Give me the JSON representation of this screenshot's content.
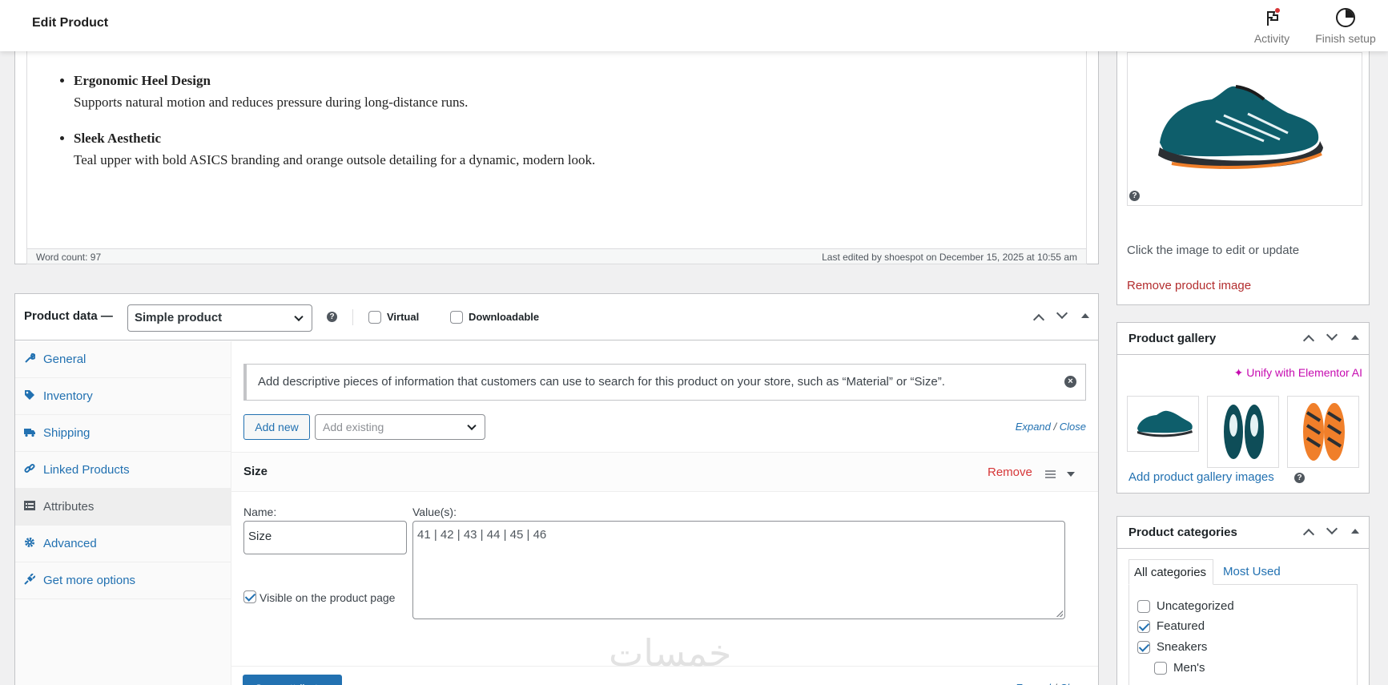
{
  "topbar": {
    "title": "Edit Product",
    "activity_label": "Activity",
    "finish_label": "Finish setup"
  },
  "description": {
    "features": [
      {
        "title": "Ergonomic Heel Design",
        "text": "Supports natural motion and reduces pressure during long-distance runs."
      },
      {
        "title": "Sleek Aesthetic",
        "text": "Teal upper with bold ASICS branding and orange outsole detailing for a dynamic, modern look."
      }
    ],
    "word_count": "Word count: 97",
    "last_edited": "Last edited by shoespot on December 15, 2025 at 10:55 am"
  },
  "product_data": {
    "label": "Product data —",
    "type_selected": "Simple product",
    "virtual_label": "Virtual",
    "downloadable_label": "Downloadable",
    "tabs": [
      {
        "label": "General",
        "icon": "wrench-icon"
      },
      {
        "label": "Inventory",
        "icon": "tag-icon"
      },
      {
        "label": "Shipping",
        "icon": "truck-icon"
      },
      {
        "label": "Linked Products",
        "icon": "link-icon"
      },
      {
        "label": "Attributes",
        "icon": "list-icon",
        "active": true
      },
      {
        "label": "Advanced",
        "icon": "gear-icon"
      },
      {
        "label": "Get more options",
        "icon": "plug-icon"
      }
    ],
    "attributes": {
      "notice": "Add descriptive pieces of information that customers can use to search for this product on your store, such as “Material” or “Size”.",
      "add_new_label": "Add new",
      "add_existing_placeholder": "Add existing",
      "expand_label": "Expand",
      "close_label": "Close",
      "attribute_name": "Size",
      "remove_label": "Remove",
      "name_label": "Name:",
      "name_value": "Size",
      "values_label": "Value(s):",
      "values_value": "41 | 42 | 43 | 44 | 45 | 46",
      "visible_label": "Visible on the product page",
      "visible_checked": true,
      "save_label": "Save attributes"
    }
  },
  "product_image": {
    "hint": "Click the image to edit or update",
    "remove_label": "Remove product image"
  },
  "product_gallery": {
    "title": "Product gallery",
    "unify_label": "Unify with Elementor AI",
    "add_label": "Add product gallery images"
  },
  "product_categories": {
    "title": "Product categories",
    "tab_all": "All categories",
    "tab_most_used": "Most Used",
    "items": [
      {
        "label": "Uncategorized",
        "checked": false
      },
      {
        "label": "Featured",
        "checked": true
      },
      {
        "label": "Sneakers",
        "checked": true
      },
      {
        "label": "Men's",
        "checked": false
      }
    ]
  },
  "colors": {
    "accent": "#2271b1",
    "danger": "#d63638",
    "elementor": "#c60bb0"
  },
  "watermark": "خمسات"
}
